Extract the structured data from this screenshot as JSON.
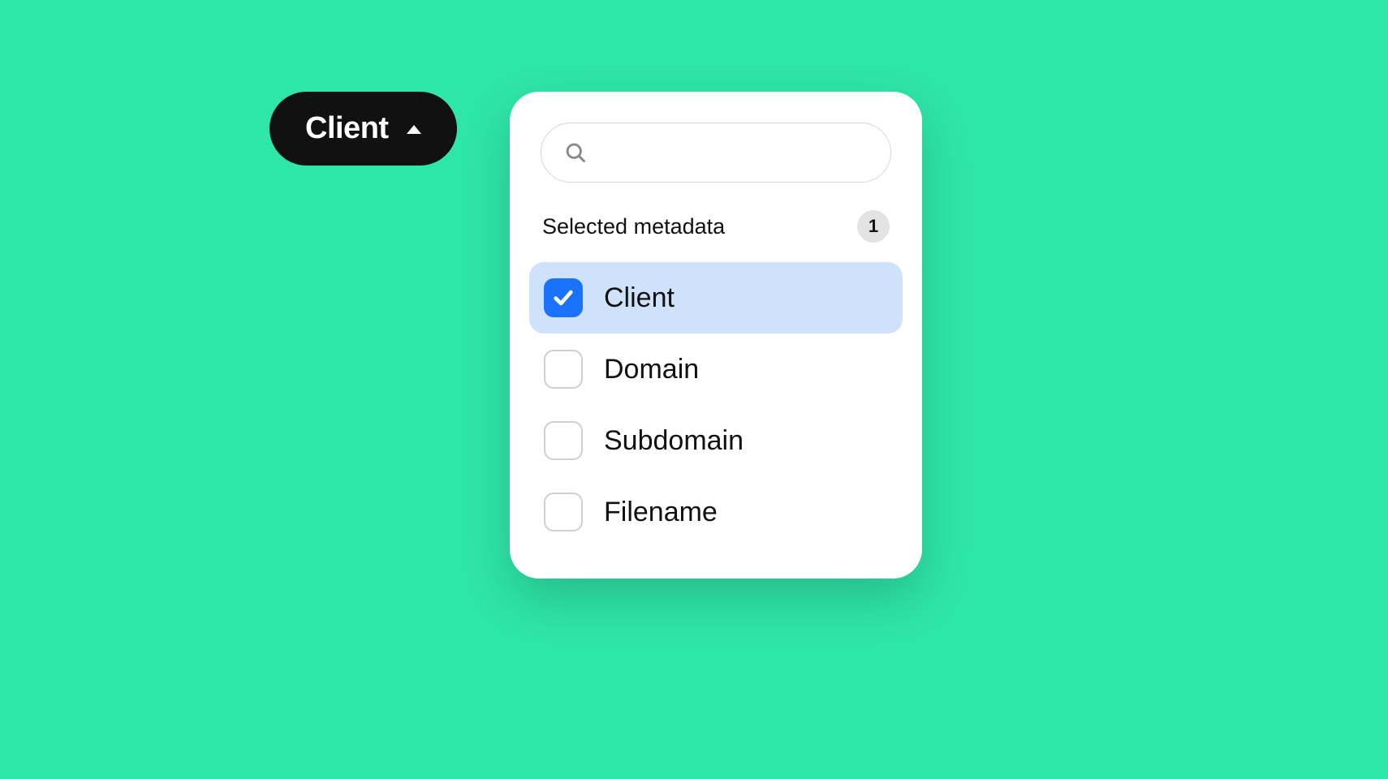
{
  "filter": {
    "label": "Client"
  },
  "dropdown": {
    "search": {
      "placeholder": ""
    },
    "section_label": "Selected metadata",
    "selected_count": "1",
    "options": [
      {
        "label": "Client",
        "checked": true
      },
      {
        "label": "Domain",
        "checked": false
      },
      {
        "label": "Subdomain",
        "checked": false
      },
      {
        "label": "Filename",
        "checked": false
      }
    ]
  }
}
